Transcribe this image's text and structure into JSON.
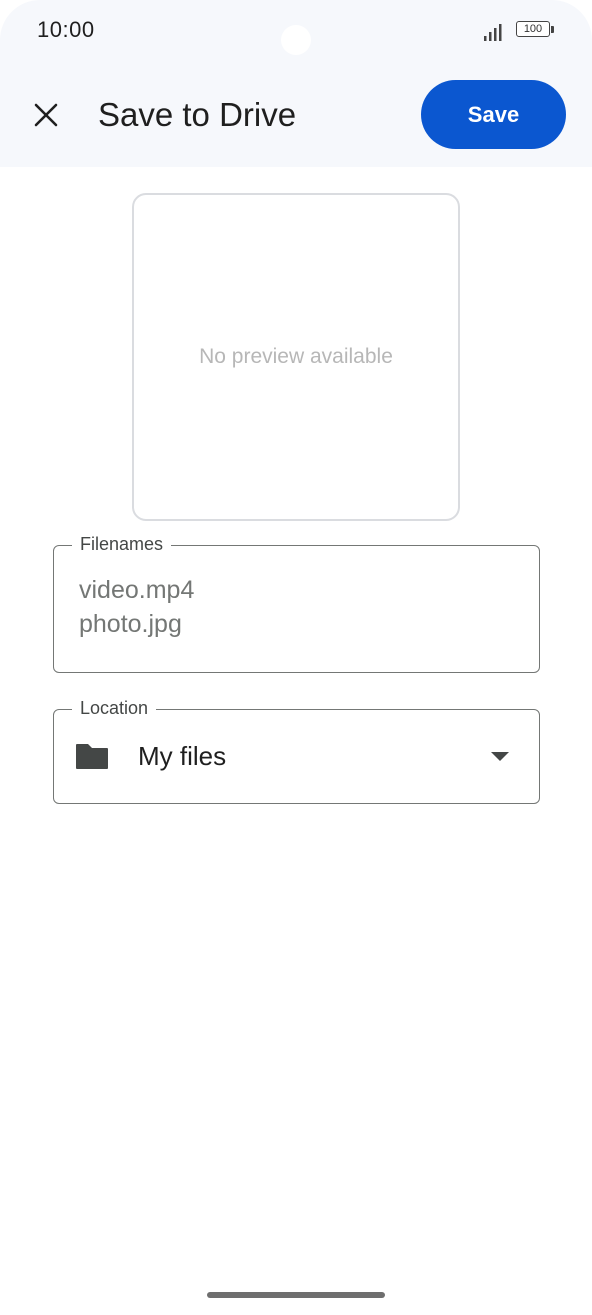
{
  "status_bar": {
    "time": "10:00",
    "battery": "100"
  },
  "header": {
    "title": "Save to Drive",
    "save_label": "Save"
  },
  "preview": {
    "message": "No preview available"
  },
  "filenames": {
    "label": "Filenames",
    "items": [
      "video.mp4",
      "photo.jpg"
    ]
  },
  "location": {
    "label": "Location",
    "value": "My files"
  },
  "colors": {
    "accent": "#0b57d0",
    "header_bg": "#f6f8fc"
  },
  "icons": {
    "close": "close-icon",
    "folder": "folder-icon",
    "dropdown": "arrow-drop-down-icon",
    "signal": "signal-icon",
    "battery": "battery-icon"
  }
}
